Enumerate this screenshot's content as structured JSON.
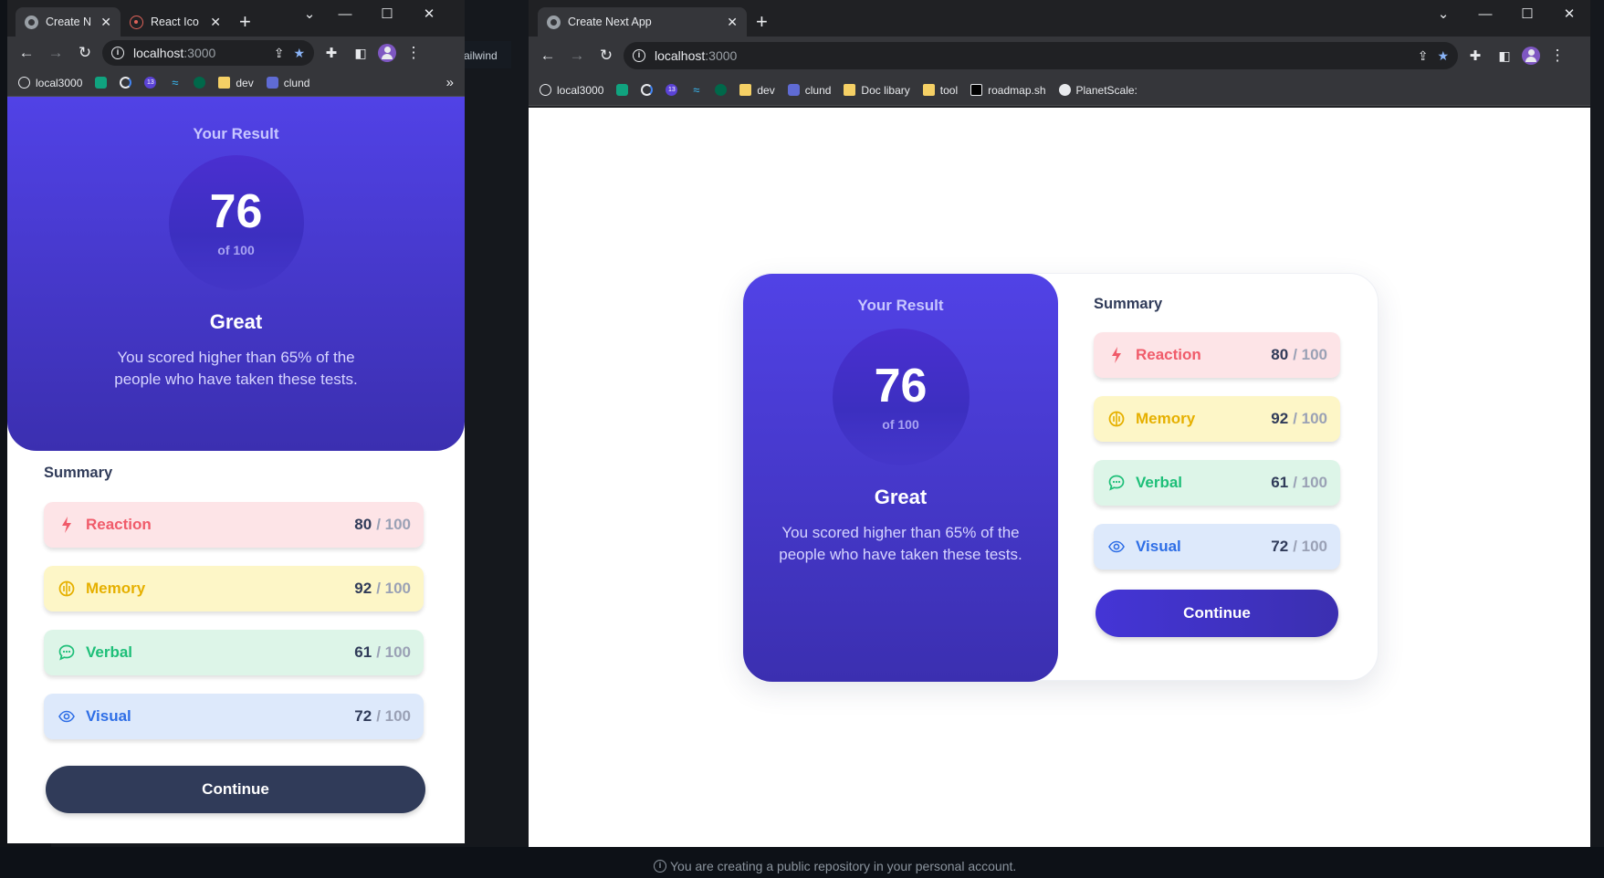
{
  "colors": {
    "gradient_top": "#5142e6",
    "gradient_bottom": "#3b2fb0",
    "reaction": "#f05b6a",
    "memory": "#e6b000",
    "verbal": "#1dbf78",
    "visual": "#2e6ee6",
    "continue_mobile": "#303b59",
    "continue_desktop": "#4435d6"
  },
  "small_browser": {
    "tabs": [
      {
        "title": "Create N",
        "icon": "globe-icon",
        "active": true
      },
      {
        "title": "React Ico",
        "icon": "react-icon",
        "active": false
      }
    ],
    "url_host": "localhost",
    "url_port": ":3000",
    "bookmarks": [
      {
        "label": "local3000",
        "icon": "globe-icon"
      },
      {
        "label": "",
        "icon": "chatgpt-icon"
      },
      {
        "label": "",
        "icon": "google-icon"
      },
      {
        "label": "",
        "icon": "badge-13-icon"
      },
      {
        "label": "",
        "icon": "tailwind-icon"
      },
      {
        "label": "",
        "icon": "mongodb-icon"
      },
      {
        "label": "dev",
        "icon": "folder-icon"
      },
      {
        "label": "clund",
        "icon": "cloud-icon"
      }
    ],
    "overflow_glyph": "»"
  },
  "large_browser": {
    "tabs": [
      {
        "title": "Create Next App",
        "icon": "globe-icon",
        "active": true
      }
    ],
    "url_host": "localhost",
    "url_port": ":3000",
    "bookmarks": [
      {
        "label": "local3000",
        "icon": "globe-icon"
      },
      {
        "label": "",
        "icon": "chatgpt-icon"
      },
      {
        "label": "",
        "icon": "google-icon"
      },
      {
        "label": "",
        "icon": "badge-13-icon"
      },
      {
        "label": "",
        "icon": "tailwind-icon"
      },
      {
        "label": "",
        "icon": "mongodb-icon"
      },
      {
        "label": "dev",
        "icon": "folder-icon"
      },
      {
        "label": "clund",
        "icon": "cloud-icon"
      },
      {
        "label": "Doc libary",
        "icon": "folder-icon"
      },
      {
        "label": "tool",
        "icon": "folder-icon"
      },
      {
        "label": "roadmap.sh",
        "icon": "roadmap-icon"
      },
      {
        "label": "PlanetScale:",
        "icon": "planetscale-icon"
      }
    ]
  },
  "background_fragment": "ailwind",
  "result": {
    "heading": "Your Result",
    "score": "76",
    "out_of": "of 100",
    "rating": "Great",
    "description": "You scored higher than 65% of the people who have taken these tests."
  },
  "summary": {
    "heading": "Summary",
    "items": [
      {
        "label": "Reaction",
        "score": "80",
        "max": "/ 100",
        "icon": "lightning-icon"
      },
      {
        "label": "Memory",
        "score": "92",
        "max": "/ 100",
        "icon": "brain-icon"
      },
      {
        "label": "Verbal",
        "score": "61",
        "max": "/ 100",
        "icon": "chat-bubble-icon"
      },
      {
        "label": "Visual",
        "score": "72",
        "max": "/ 100",
        "icon": "eye-icon"
      }
    ],
    "continue_label": "Continue"
  },
  "desktop_notice": "You are creating a public repository in your personal account."
}
